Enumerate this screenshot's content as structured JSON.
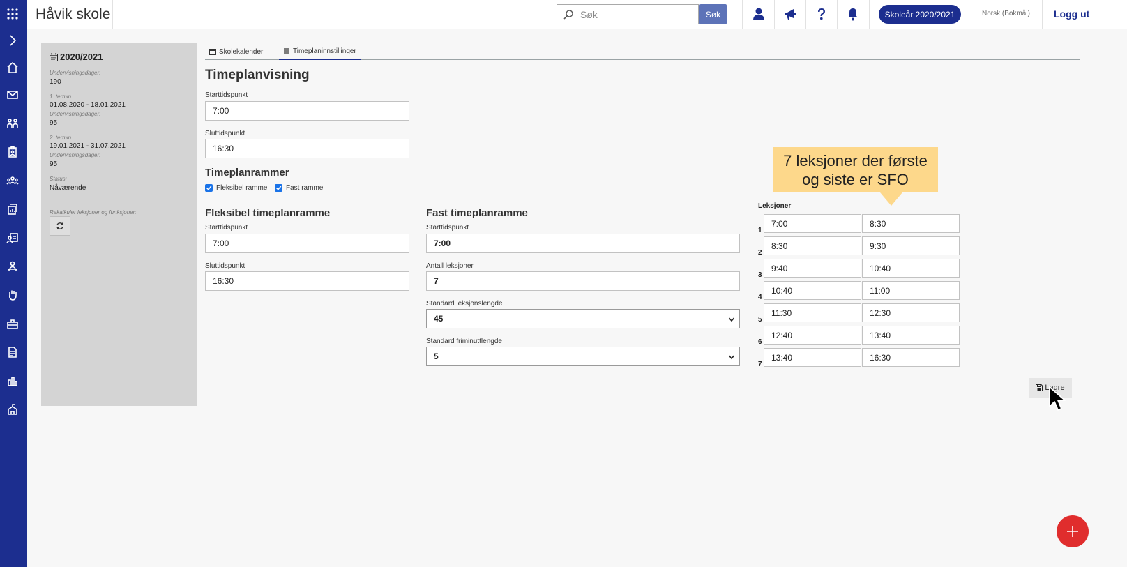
{
  "header": {
    "school_name": "Håvik skole",
    "search_placeholder": "Søk",
    "search_button": "Søk",
    "school_year_button": "Skoleår 2020/2021",
    "language": "Norsk (Bokmål)",
    "logout": "Logg ut"
  },
  "rail_icons": [
    "apps-grid-icon",
    "chevron-right-icon",
    "home-icon",
    "mail-icon",
    "groups-icon",
    "clipboard-icon",
    "people-icon",
    "chart-doc-icon",
    "calendar-person-icon",
    "person-desk-icon",
    "hand-icon",
    "briefcase-icon",
    "document-icon",
    "bar-chart-icon",
    "school-icon"
  ],
  "info_panel": {
    "year": "2020/2021",
    "teaching_days_label": "Undervisningsdager:",
    "teaching_days": "190",
    "term1_label": "1. termin",
    "term1_dates": "01.08.2020 - 18.01.2021",
    "term1_days_label": "Undervisningsdager:",
    "term1_days": "95",
    "term2_label": "2. termin",
    "term2_dates": "19.01.2021 - 31.07.2021",
    "term2_days_label": "Undervisningsdager:",
    "term2_days": "95",
    "status_label": "Status:",
    "status": "Nåværende",
    "recalc_label": "Rekalkuler leksjoner og funksjoner:"
  },
  "tabs": [
    {
      "label": "Skolekalender"
    },
    {
      "label": "Timeplaninnstillinger"
    }
  ],
  "timeplanvisning": {
    "title": "Timeplanvisning",
    "start_label": "Starttidspunkt",
    "start_value": "7:00",
    "end_label": "Sluttidspunkt",
    "end_value": "16:30"
  },
  "timeplanrammer": {
    "title": "Timeplanrammer",
    "flex_label": "Fleksibel ramme",
    "fixed_label": "Fast ramme"
  },
  "flex_frame": {
    "title": "Fleksibel timeplanramme",
    "start_label": "Starttidspunkt",
    "start_value": "7:00",
    "end_label": "Sluttidspunkt",
    "end_value": "16:30"
  },
  "fixed_frame": {
    "title": "Fast timeplanramme",
    "start_label": "Starttidspunkt",
    "start_value": "7:00",
    "lessons_label": "Antall leksjoner",
    "lessons_value": "7",
    "lesson_length_label": "Standard leksjonslengde",
    "lesson_length_value": "45",
    "break_length_label": "Standard friminuttlengde",
    "break_length_value": "5"
  },
  "lessons": {
    "title": "Leksjoner",
    "rows": [
      {
        "num": "1",
        "start": "7:00",
        "end": "8:30"
      },
      {
        "num": "2",
        "start": "8:30",
        "end": "9:30"
      },
      {
        "num": "3",
        "start": "9:40",
        "end": "10:40"
      },
      {
        "num": "4",
        "start": "10:40",
        "end": "11:00"
      },
      {
        "num": "5",
        "start": "11:30",
        "end": "12:30"
      },
      {
        "num": "6",
        "start": "12:40",
        "end": "13:40"
      },
      {
        "num": "7",
        "start": "13:40",
        "end": "16:30"
      }
    ]
  },
  "callout": {
    "line1": "7 leksjoner der første",
    "line2": "og siste er SFO"
  },
  "save_button": "Lagre"
}
